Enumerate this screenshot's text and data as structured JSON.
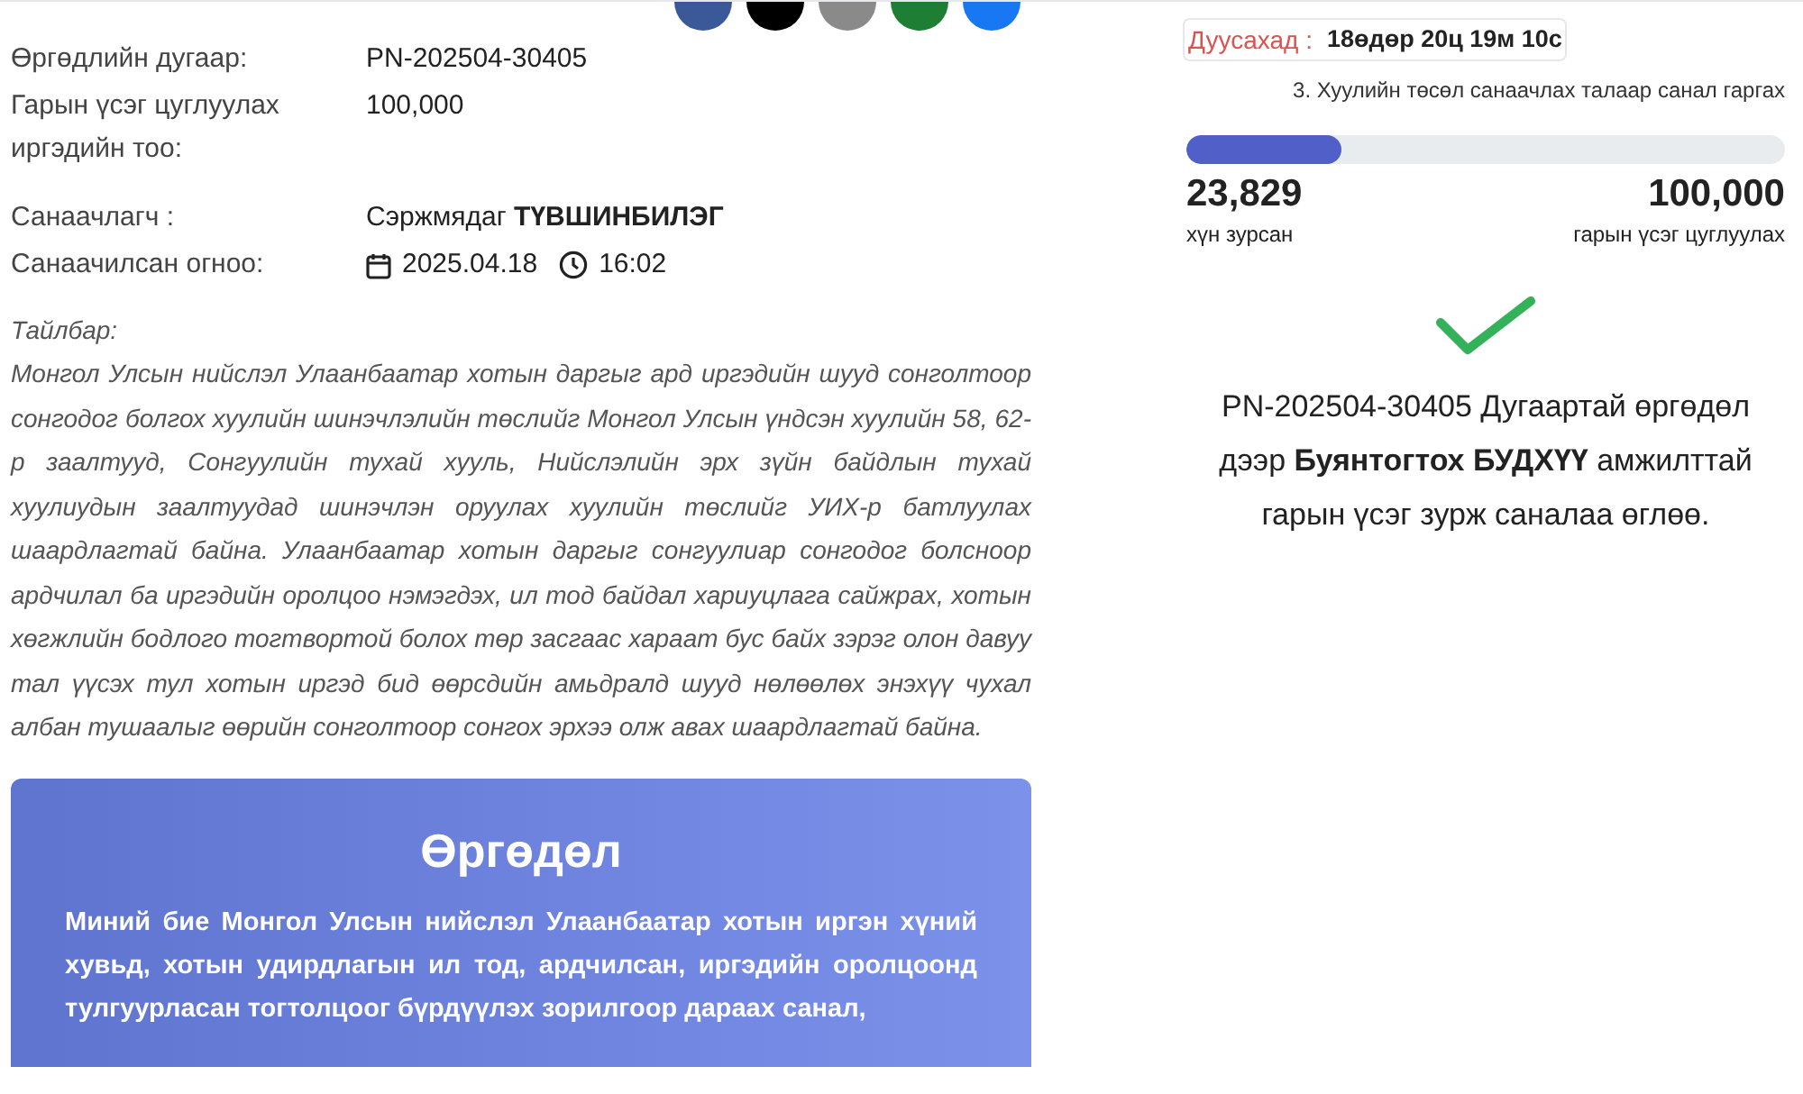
{
  "share_buttons": [
    {
      "kind": "facebook"
    },
    {
      "kind": "x"
    },
    {
      "kind": "email"
    },
    {
      "kind": "copy"
    },
    {
      "kind": "embed"
    }
  ],
  "details": [
    {
      "label": "Өргөдлийн дугаар:",
      "value": "PN-202504-30405"
    },
    {
      "label": "Гарын үсэг цуглуулах иргэдийн тоо:",
      "value": "100,000"
    }
  ],
  "initiator": {
    "label": "Санаачлагч :",
    "value": "Сэржмядаг **ТҮВШИНБИЛЭГ**"
  },
  "date": {
    "label": "Санаачилсан огноо:",
    "date": "2025.04.18",
    "time": "16:02"
  },
  "description": {
    "label": "Тайлбар:",
    "text": "Монгол Улсын нийслэл Улаанбаатар хотын даргыг ард иргэдийн шууд сонголтоор сонгодог болгох хуулийн шинэчлэлийн төслийг Монгол Улсын үндсэн хуулийн 58, 62-р заалтууд, Сонгуулийн тухай хууль, Нийслэлийн эрх зүйн байдлын тухай хуулиудын заалтуудад шинэчлэн оруулах хуулийн төслийг УИХ-р батлуулах шаардлагтай байна. Улаанбаатар хотын даргыг сонгуулиар сонгодог болсноор ардчилал ба иргэдийн оролцоо нэмэгдэх, ил тод байдал хариуцлага сайжрах, хотын хөгжлийн бодлого тогтвортой болох төр засгаас хараат бус байх зэрэг олон давуу тал үүсэх тул хотын иргэд бид өөрсдийн амьдралд шууд нөлөөлөх энэхүү чухал албан тушаалыг өөрийн сонголтоор сонгох эрхээ олж авах шаардлагтай байна."
  },
  "petition": {
    "title": "Өргөдөл",
    "text": "Миний бие Монгол Улсын нийслэл Улаанбаатар хотын иргэн хүний хувьд, хотын удирдлагын ил тод, ардчилсан, иргэдийн оролцоонд тулгуурласан тогтолцоог бүрдүүлэх зорилгоор дараах санал,"
  },
  "countdown": {
    "label": "Дуусахад :",
    "value": "18өдөр 20ц 19м 10с"
  },
  "category": "3. Хуулийн төсөл санаачлах талаар санал гаргах",
  "progress": {
    "level": 0.26,
    "signed": "23,829",
    "signed_label": "хүн зурсан",
    "goal": "100,000",
    "goal_label": "гарын үсэг цуглуулах"
  },
  "success": {
    "text": "PN-202504-30405 Дугаартай өргөдөл дээр **Буянтогтох БУДХҮҮ** амжилттай гарын үсэг зурж саналаа өглөө."
  }
}
